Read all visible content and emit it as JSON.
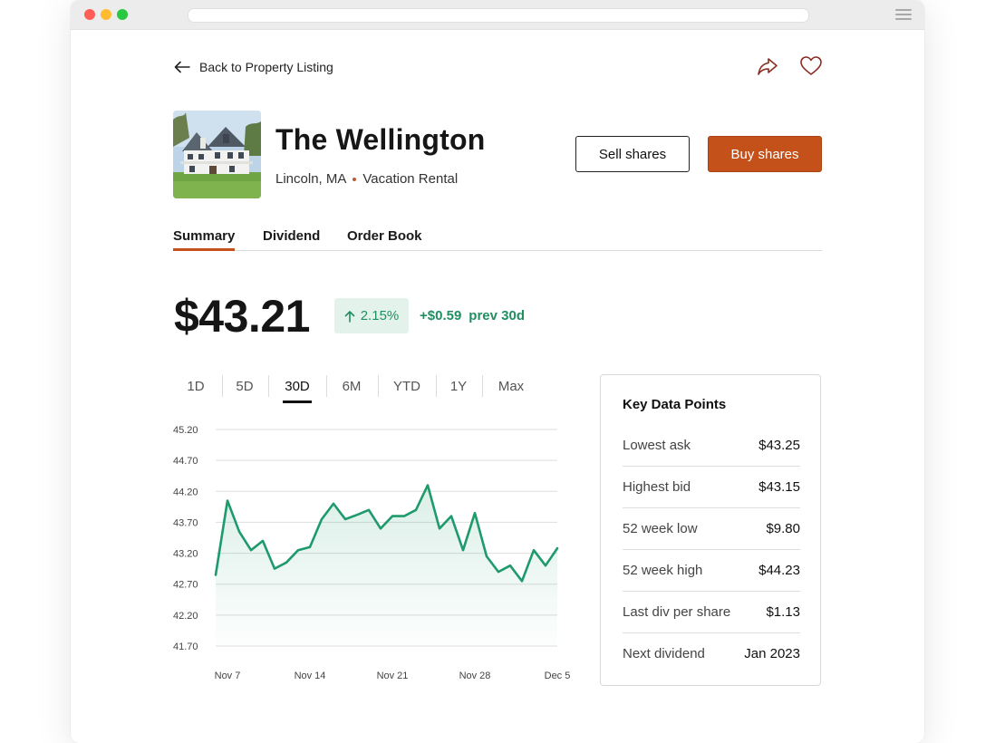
{
  "nav": {
    "back_label": "Back to Property Listing"
  },
  "property": {
    "title": "The Wellington",
    "location": "Lincoln, MA",
    "category": "Vacation Rental"
  },
  "actions": {
    "sell_label": "Sell shares",
    "buy_label": "Buy shares"
  },
  "tabs": [
    {
      "label": "Summary",
      "active": true
    },
    {
      "label": "Dividend",
      "active": false
    },
    {
      "label": "Order Book",
      "active": false
    }
  ],
  "price": {
    "current": "$43.21",
    "change_percent": "2.15%",
    "change_amount": "+$0.59",
    "change_period": "prev 30d"
  },
  "ranges": [
    {
      "label": "1D",
      "active": false
    },
    {
      "label": "5D",
      "active": false
    },
    {
      "label": "30D",
      "active": true
    },
    {
      "label": "6M",
      "active": false
    },
    {
      "label": "YTD",
      "active": false
    },
    {
      "label": "1Y",
      "active": false
    },
    {
      "label": "Max",
      "active": false
    }
  ],
  "key_data": {
    "title": "Key Data Points",
    "rows": [
      {
        "label": "Lowest ask",
        "value": "$43.25"
      },
      {
        "label": "Highest bid",
        "value": "$43.15"
      },
      {
        "label": "52 week low",
        "value": "$9.80"
      },
      {
        "label": "52 week high",
        "value": "$44.23"
      },
      {
        "label": "Last div per share",
        "value": "$1.13"
      },
      {
        "label": "Next dividend",
        "value": "Jan 2023"
      }
    ]
  },
  "colors": {
    "accent": "#c4511a",
    "positive": "#1f8f62",
    "line": "#1e9a6c"
  },
  "icons": {
    "back": "arrow-left-icon",
    "share": "share-icon",
    "favorite": "heart-icon"
  },
  "chart_data": {
    "type": "area",
    "y_ticks": [
      "45.20",
      "44.70",
      "44.20",
      "43.70",
      "43.20",
      "42.70",
      "42.20",
      "41.70"
    ],
    "ylim": [
      41.7,
      45.2
    ],
    "x_tick_labels": [
      "Nov 7",
      "Nov 14",
      "Nov 21",
      "Nov 28",
      "Dec 5"
    ],
    "x_tick_index": [
      1,
      8,
      15,
      22,
      29
    ],
    "values": [
      42.85,
      44.05,
      43.55,
      43.25,
      43.4,
      42.95,
      43.05,
      43.25,
      43.3,
      43.75,
      44.0,
      43.75,
      43.82,
      43.9,
      43.6,
      43.8,
      43.8,
      43.9,
      44.3,
      43.6,
      43.8,
      43.25,
      43.85,
      43.15,
      42.9,
      43.0,
      42.75,
      43.25,
      43.0,
      43.28
    ],
    "grid": true,
    "legend": "none"
  }
}
